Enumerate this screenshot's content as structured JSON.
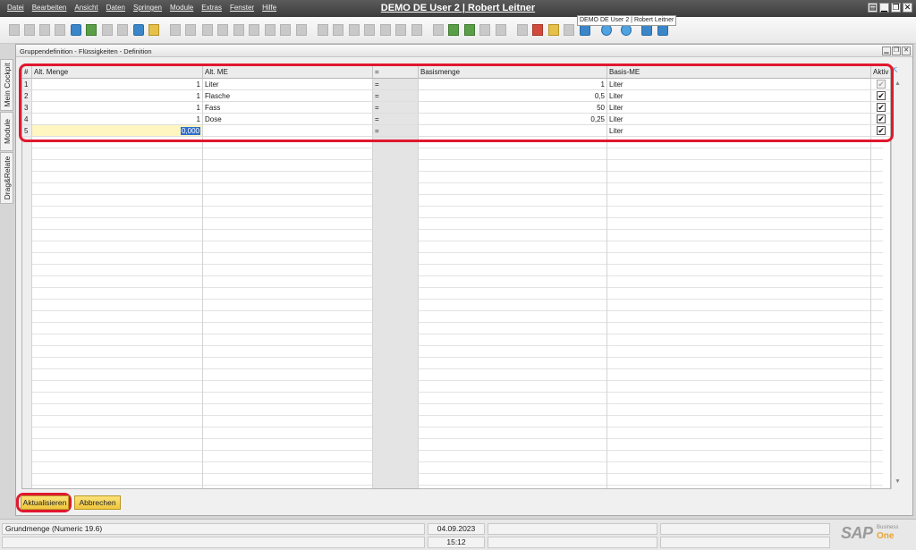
{
  "app": {
    "title": "DEMO DE User 2 | Robert Leitner",
    "tooltip": "DEMO DE User 2 | Robert Leitner",
    "menu": [
      "Datei",
      "Bearbeiten",
      "Ansicht",
      "Daten",
      "Springen",
      "Module",
      "Extras",
      "Fenster",
      "Hilfe"
    ],
    "window_controls": [
      "▤",
      "▁",
      "❐",
      "✕"
    ]
  },
  "sidebar": {
    "tabs": [
      "Mein Cockpit",
      "Module",
      "Drag&Relate"
    ]
  },
  "form": {
    "title": "Gruppendefinition - Flüssigkeiten - Definition",
    "controls": [
      "▁",
      "❐",
      "✕"
    ],
    "columns": [
      "#",
      "Alt. Menge",
      "Alt. ME",
      "=",
      "Basismenge",
      "Basis-ME",
      "Aktiv"
    ],
    "rows": [
      {
        "num": "1",
        "alt_qty": "1",
        "alt_unit": "Liter",
        "eq": "=",
        "base_qty": "1",
        "base_unit": "Liter",
        "active": "✔",
        "disabled": true
      },
      {
        "num": "2",
        "alt_qty": "1",
        "alt_unit": "Flasche",
        "eq": "=",
        "base_qty": "0,5",
        "base_unit": "Liter",
        "active": "✔",
        "disabled": false
      },
      {
        "num": "3",
        "alt_qty": "1",
        "alt_unit": "Fass",
        "eq": "=",
        "base_qty": "50",
        "base_unit": "Liter",
        "active": "✔",
        "disabled": false
      },
      {
        "num": "4",
        "alt_qty": "1",
        "alt_unit": "Dose",
        "eq": "=",
        "base_qty": "0,25",
        "base_unit": "Liter",
        "active": "✔",
        "disabled": false
      },
      {
        "num": "5",
        "alt_qty": "0,000",
        "alt_unit": "",
        "eq": "=",
        "base_qty": "",
        "base_unit": "Liter",
        "active": "✔",
        "disabled": false
      }
    ],
    "buttons": {
      "update": "Aktualisieren",
      "cancel": "Abbrechen"
    }
  },
  "status": {
    "field_info": "Grundmenge (Numeric 19.6)",
    "date": "04.09.2023",
    "time": "15:12",
    "brand_sap": "SAP",
    "brand_business": "Business",
    "brand_one": "One"
  },
  "colors": {
    "highlight": "#e0182f",
    "button": "#f0c63c",
    "current_row": "#fff6c2",
    "selection": "#2f6fcc"
  }
}
